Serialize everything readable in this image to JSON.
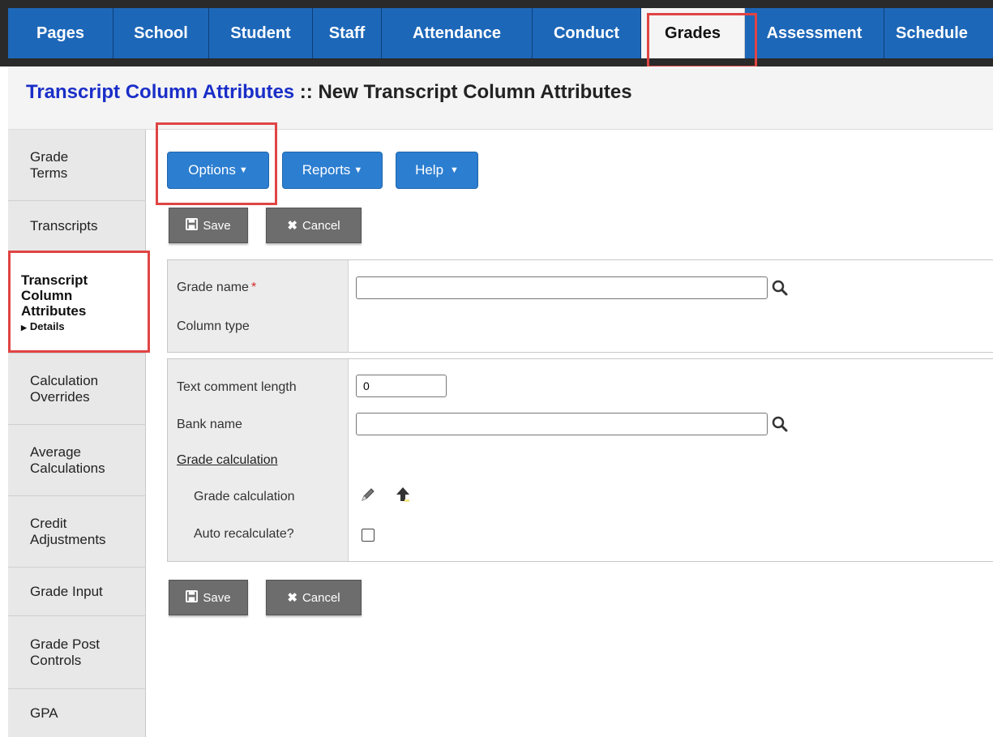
{
  "nav": {
    "tabs": [
      "Pages",
      "School",
      "Student",
      "Staff",
      "Attendance",
      "Conduct",
      "Grades",
      "Assessment",
      "Schedule"
    ],
    "active": "Grades"
  },
  "title": {
    "link": "Transcript Column Attributes",
    "separator": " :: ",
    "current": "New Transcript Column Attributes"
  },
  "sidebar": {
    "items": [
      {
        "label": "Grade Terms"
      },
      {
        "label": "Transcripts"
      },
      {
        "label": "Transcript Column Attributes",
        "sub": "Details"
      },
      {
        "label": "Calculation Overrides"
      },
      {
        "label": "Average Calculations"
      },
      {
        "label": "Credit Adjustments"
      },
      {
        "label": "Grade Input"
      },
      {
        "label": "Grade Post Controls"
      },
      {
        "label": "GPA"
      }
    ]
  },
  "toolbar": {
    "options": "Options",
    "reports": "Reports",
    "help": "Help",
    "save": "Save",
    "cancel": "Cancel"
  },
  "form": {
    "grade_name_label": "Grade name",
    "required_mark": "*",
    "grade_name_value": "",
    "column_type_label": "Column type",
    "text_comment_length_label": "Text comment length",
    "text_comment_length_value": "0",
    "bank_name_label": "Bank name",
    "bank_name_value": "",
    "grade_calculation_header": "Grade calculation",
    "grade_calculation_label": "Grade calculation",
    "auto_recalculate_label": "Auto recalculate?",
    "auto_recalculate_checked": false
  },
  "colors": {
    "nav_blue": "#1d67b8",
    "button_blue": "#2c7ed0",
    "title_blue": "#1a2ec8",
    "highlight_red": "#e04444"
  }
}
